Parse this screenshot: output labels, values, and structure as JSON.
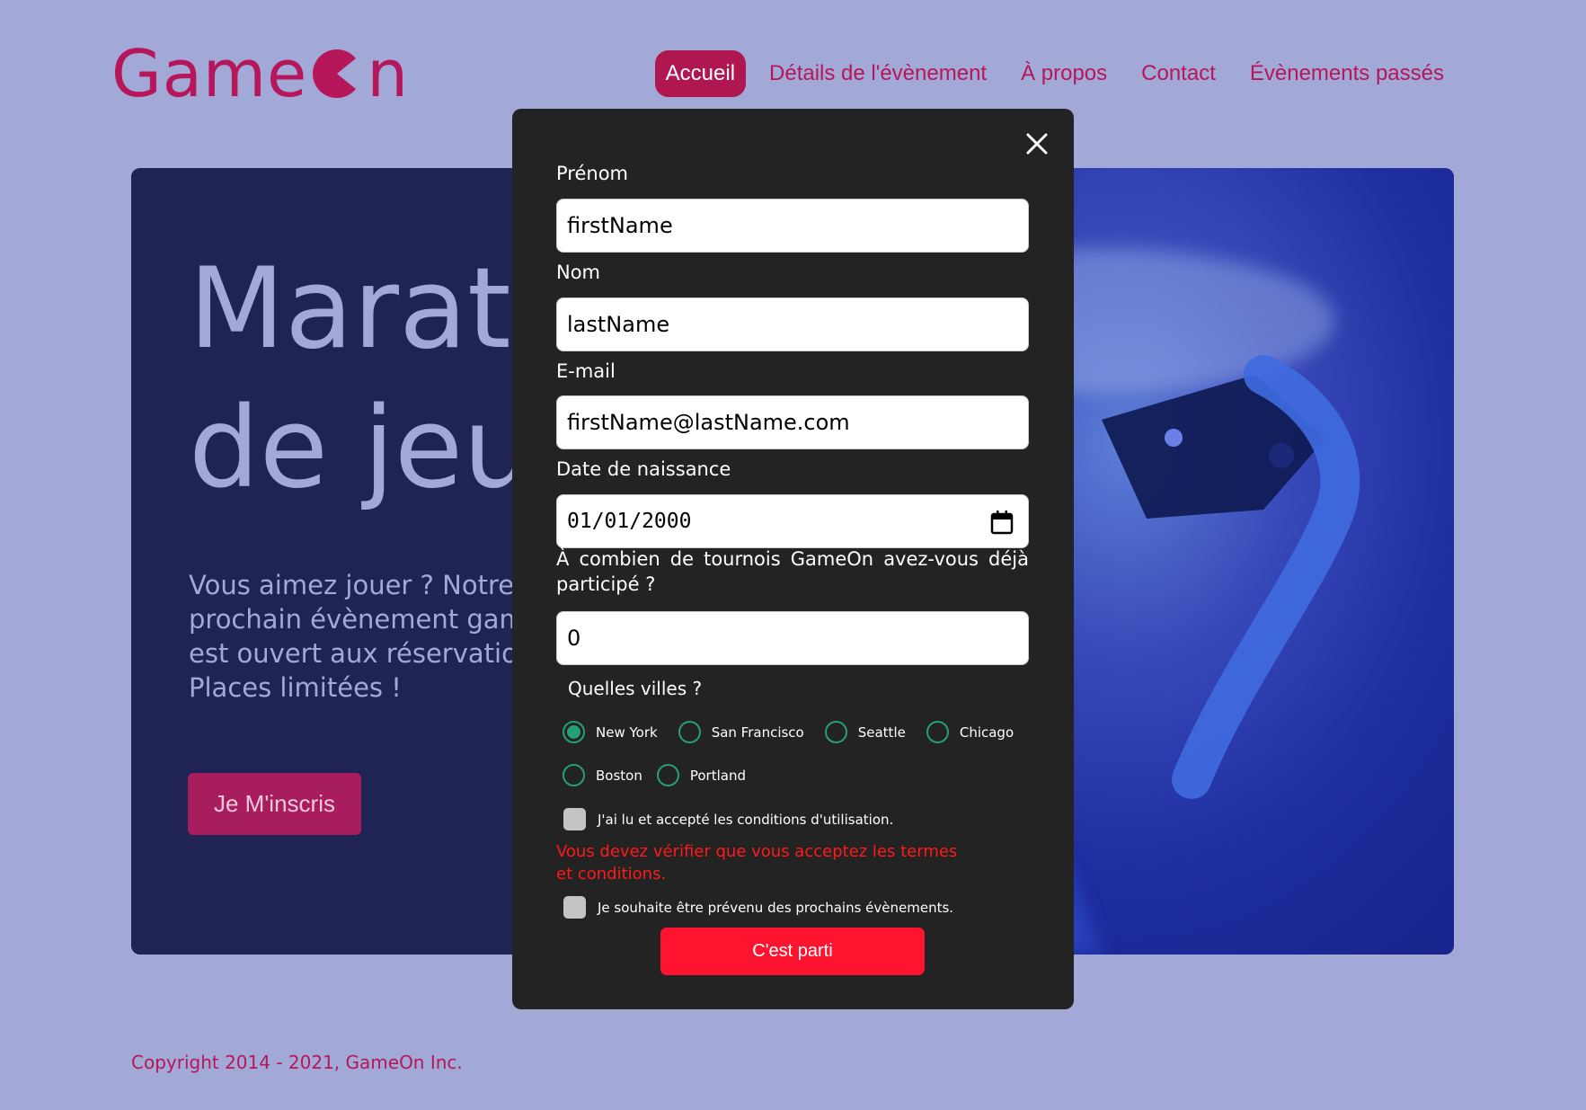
{
  "brand": {
    "logo_left": "Game",
    "logo_right": "n",
    "color": "#b5175a"
  },
  "nav": {
    "items": [
      {
        "label": "Accueil",
        "active": true
      },
      {
        "label": "Détails de l'évènement",
        "active": false
      },
      {
        "label": "À propos",
        "active": false
      },
      {
        "label": "Contact",
        "active": false
      },
      {
        "label": "Évènements passés",
        "active": false
      }
    ]
  },
  "hero": {
    "title_line1": "Marath",
    "title_line2": "de jeux",
    "text_lines": [
      "Vous aimez jouer ? Notre",
      "prochain évènement gamir",
      "est ouvert aux réservations",
      "Places limitées !"
    ],
    "cta_label": "Je M'inscris"
  },
  "modal": {
    "close_icon": "close-icon",
    "first_name": {
      "label": "Prénom",
      "value": "firstName"
    },
    "last_name": {
      "label": "Nom",
      "value": "lastName"
    },
    "email": {
      "label": "E-mail",
      "value": "firstName@lastName.com"
    },
    "birthdate": {
      "label": "Date de naissance",
      "value": "01/01/2000"
    },
    "quantity": {
      "label_line1": "À combien de tournois GameOn avez-vous déjà",
      "label_line2": "participé ?",
      "value": "0"
    },
    "cities": {
      "label": "Quelles villes ?",
      "options": [
        {
          "label": "New York",
          "checked": true
        },
        {
          "label": "San Francisco",
          "checked": false
        },
        {
          "label": "Seattle",
          "checked": false
        },
        {
          "label": "Chicago",
          "checked": false
        },
        {
          "label": "Boston",
          "checked": false
        },
        {
          "label": "Portland",
          "checked": false
        }
      ]
    },
    "terms": {
      "label": "J'ai lu et accepté les conditions d'utilisation.",
      "checked": false
    },
    "error": "Vous devez vérifier que vous acceptez les termes et conditions.",
    "newsletter": {
      "label": "Je souhaite être prévenu des prochains évènements.",
      "checked": false
    },
    "submit_label": "C'est parti"
  },
  "footer": {
    "copyright": "Copyright 2014 - 2021, GameOn Inc."
  },
  "colors": {
    "background": "#a2a9d7",
    "accent": "#b0164f",
    "modal_bg": "#232323",
    "radio": "#279e7a",
    "submit": "#fe142f",
    "error": "#ff1a1a"
  }
}
